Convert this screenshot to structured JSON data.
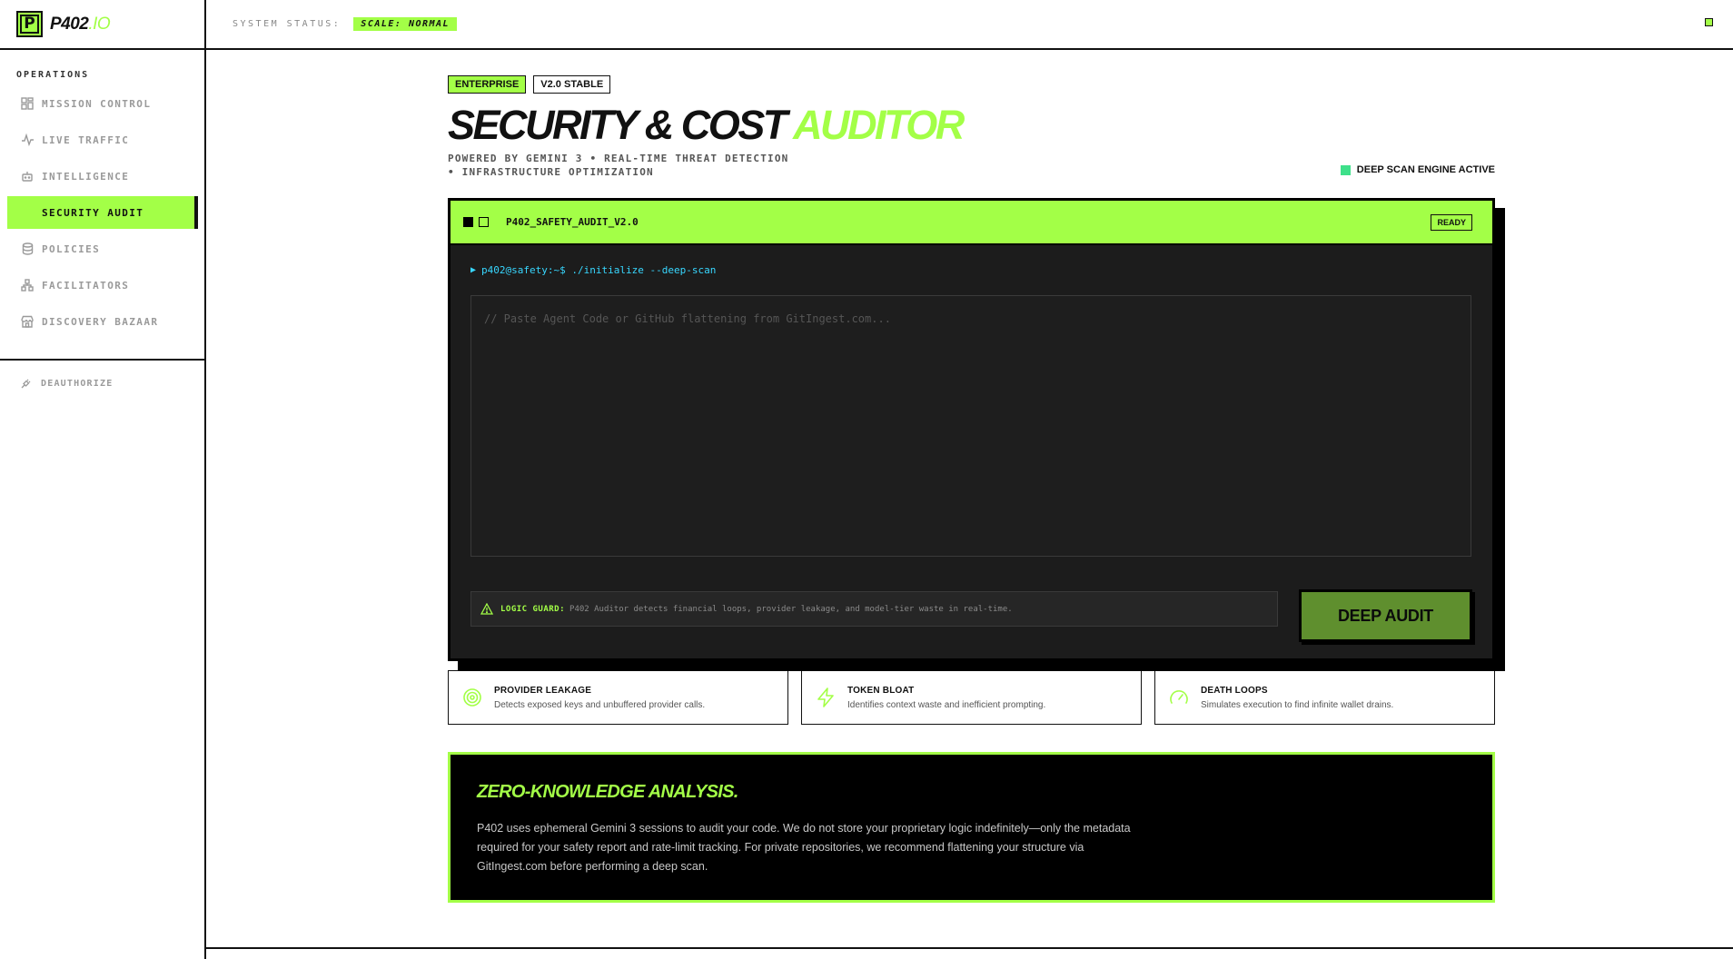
{
  "brand": {
    "name": "P402",
    "suffix": ".IO",
    "logo_letter": "P"
  },
  "topbar": {
    "status_label": "SYSTEM STATUS:",
    "status_value": "SCALE: NORMAL"
  },
  "sidebar": {
    "section_title": "OPERATIONS",
    "items": [
      {
        "label": "MISSION CONTROL",
        "icon": "dashboard-icon"
      },
      {
        "label": "LIVE TRAFFIC",
        "icon": "activity-icon"
      },
      {
        "label": "INTELLIGENCE",
        "icon": "bot-icon"
      },
      {
        "label": "SECURITY AUDIT",
        "icon": "shield-icon",
        "active": true
      },
      {
        "label": "POLICIES",
        "icon": "database-icon"
      },
      {
        "label": "FACILITATORS",
        "icon": "network-icon"
      },
      {
        "label": "DISCOVERY BAZAAR",
        "icon": "store-icon"
      }
    ],
    "deauthorize": "DEAUTHORIZE"
  },
  "header": {
    "badges": [
      "ENTERPRISE",
      "V2.0 STABLE"
    ],
    "title_main": "SECURITY & COST",
    "title_accent": "AUDITOR",
    "subtitle": "POWERED BY GEMINI 3 • REAL-TIME THREAT DETECTION • INFRASTRUCTURE OPTIMIZATION",
    "engine_status": "DEEP SCAN ENGINE ACTIVE"
  },
  "terminal": {
    "title": "P402_SAFETY_AUDIT_V2.0",
    "status": "READY",
    "prompt": "p402@safety:~$ ./initialize --deep-scan",
    "input_placeholder": "// Paste Agent Code or GitHub flattening from GitIngest.com...",
    "input_value": "",
    "guard_label": "LOGIC GUARD:",
    "guard_text": "P402 Auditor detects financial loops, provider leakage, and model-tier waste in real-time.",
    "action_label": "DEEP AUDIT"
  },
  "features": [
    {
      "title": "PROVIDER LEAKAGE",
      "desc": "Detects exposed keys and unbuffered provider calls.",
      "icon": "target-icon"
    },
    {
      "title": "TOKEN BLOAT",
      "desc": "Identifies context waste and inefficient prompting.",
      "icon": "zap-icon"
    },
    {
      "title": "DEATH LOOPS",
      "desc": "Simulates execution to find infinite wallet drains.",
      "icon": "gauge-icon"
    }
  ],
  "zk": {
    "title": "ZERO-KNOWLEDGE ANALYSIS.",
    "body": "P402 uses ephemeral Gemini 3 sessions to audit your code. We do not store your proprietary logic indefinitely—only the metadata required for your safety report and rate-limit tracking. For private repositories, we recommend flattening your structure via GitIngest.com before performing a deep scan."
  },
  "colors": {
    "accent": "#a3ff47",
    "engine_indicator": "#3ee08a",
    "prompt": "#38d7ff",
    "button": "#5f8f2e",
    "dark": "#1c1c1c"
  }
}
